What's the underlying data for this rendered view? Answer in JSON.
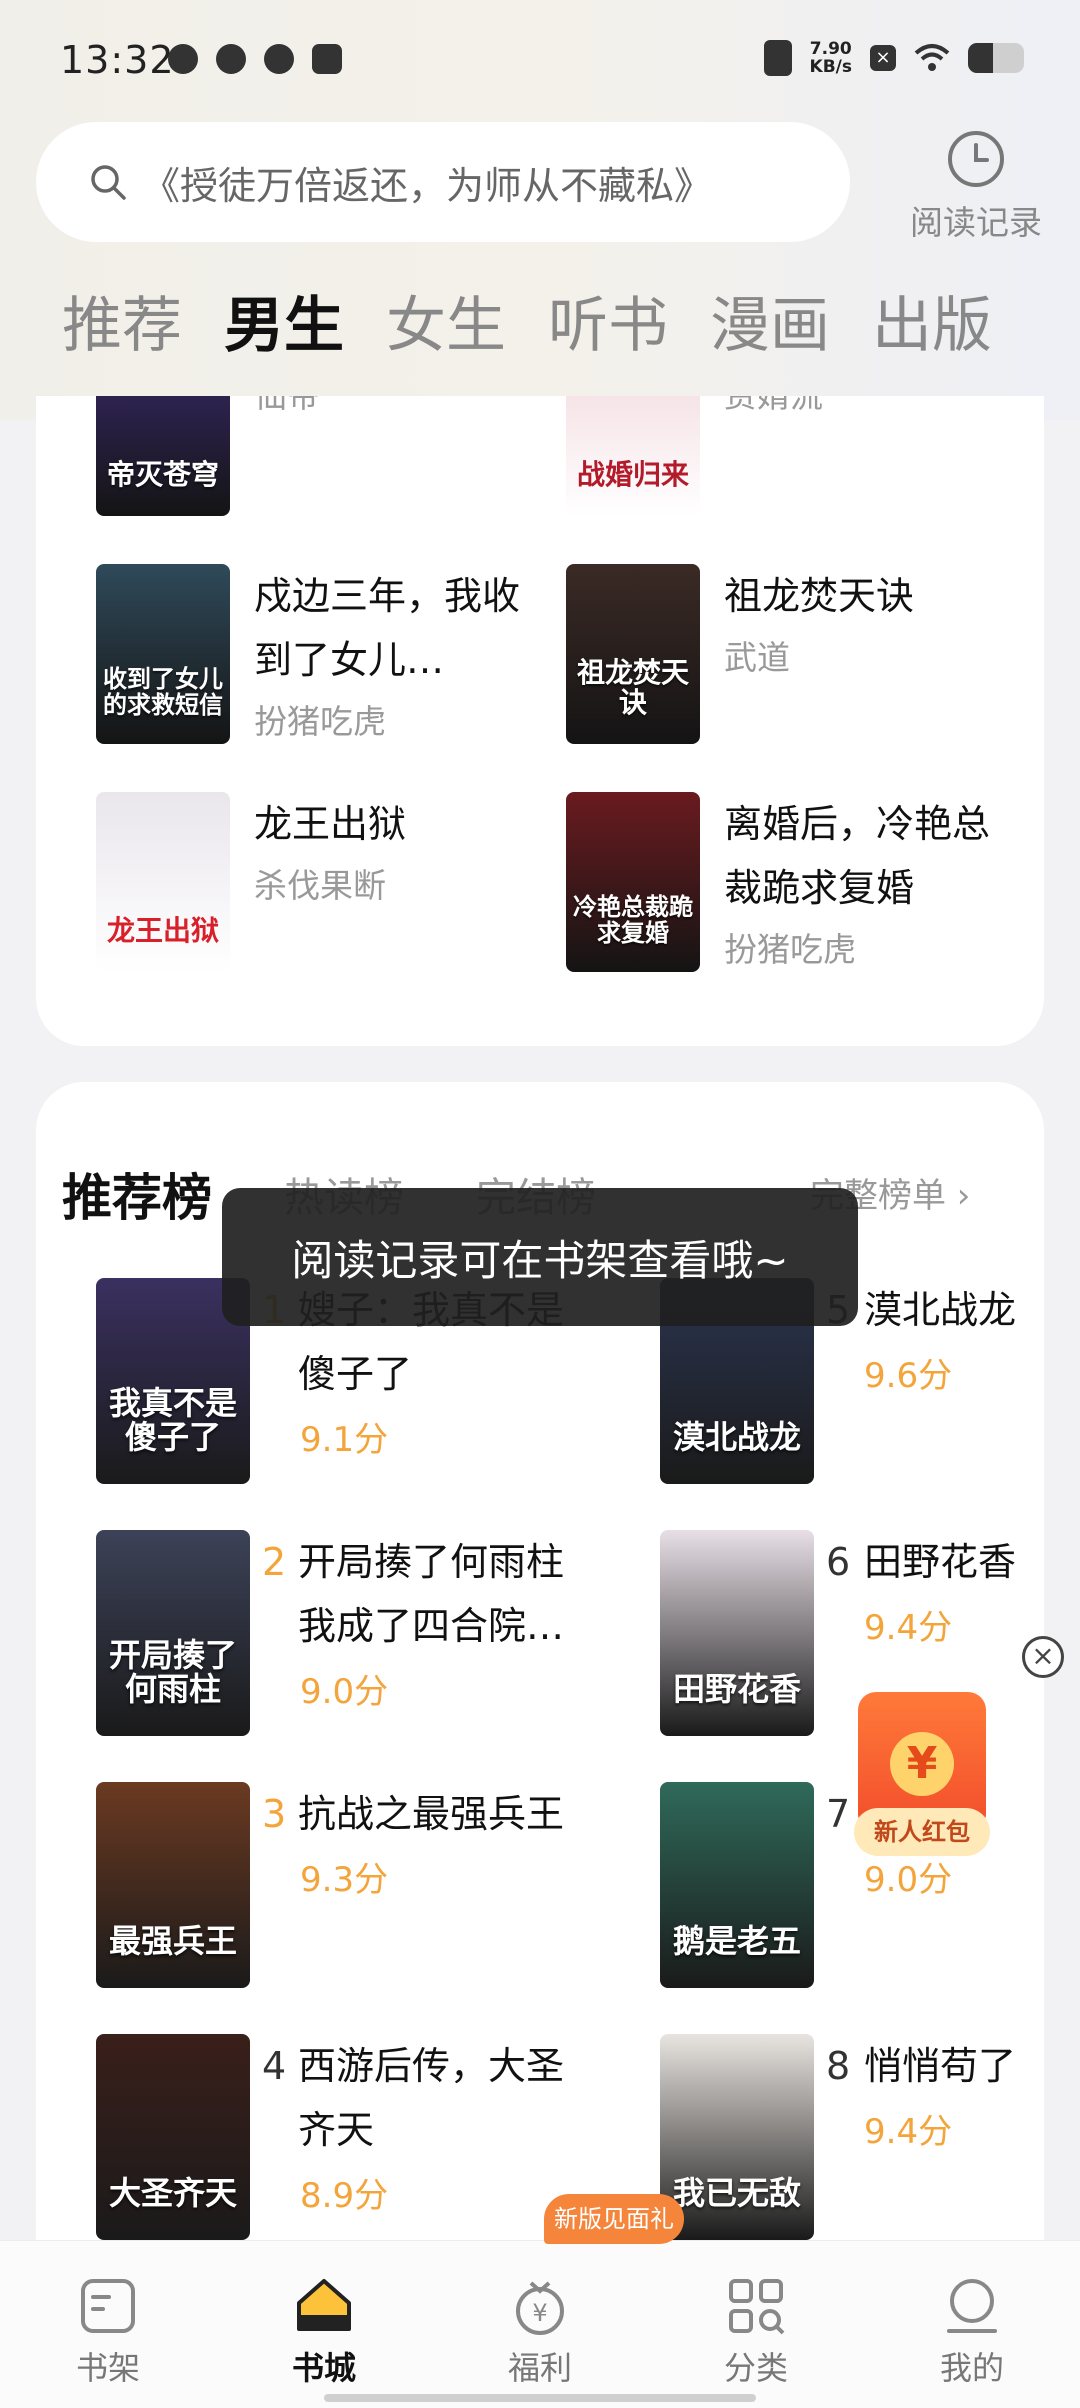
{
  "status_bar": {
    "time": "13:32",
    "net_speed_value": "7.90",
    "net_speed_unit": "KB/s",
    "battery_level": 0.45
  },
  "search": {
    "placeholder": "《授徒万倍返还，为师从不藏私》",
    "history_label": "阅读记录"
  },
  "channel_tabs": [
    {
      "label": "推荐",
      "active": false
    },
    {
      "label": "男生",
      "active": true
    },
    {
      "label": "女生",
      "active": false
    },
    {
      "label": "听书",
      "active": false
    },
    {
      "label": "漫画",
      "active": false
    },
    {
      "label": "出版",
      "active": false
    }
  ],
  "book_grid": [
    {
      "title": "",
      "author": "仙帝",
      "cover_text": "帝灭苍穹",
      "cover_color": "#3a2a6e"
    },
    {
      "title": "",
      "author": "赘婿流",
      "cover_text": "战婚归来",
      "cover_color": "#f1d6dc"
    },
    {
      "title": "戍边三年，我收到了女儿…",
      "author": "扮猪吃虎",
      "cover_text": "收到了女儿的求救短信",
      "cover_color": "#2f4a5a"
    },
    {
      "title": "祖龙焚天诀",
      "author": "武道",
      "cover_text": "祖龙焚天诀",
      "cover_color": "#3b2a25"
    },
    {
      "title": "龙王出狱",
      "author": "杀伐果断",
      "cover_text": "龙王出狱",
      "cover_color": "#e9e6ec"
    },
    {
      "title": "离婚后，冷艳总裁跪求复婚",
      "author": "扮猪吃虎",
      "cover_text": "冷艳总裁跪求复婚",
      "cover_color": "#6a1b1f"
    }
  ],
  "rank_tabs": [
    {
      "label": "推荐榜",
      "active": true
    },
    {
      "label": "热读榜",
      "active": false
    },
    {
      "label": "完结榜",
      "active": false
    }
  ],
  "full_rank_label": "完整榜单 ›",
  "rankings": [
    {
      "rank": "1",
      "title": "嫂子：我真不是傻子了",
      "score": "9.1分",
      "cover_text": "我真不是傻子了",
      "cover_color": "#3a3160"
    },
    {
      "rank": "2",
      "title": "开局揍了何雨柱我成了四合院…",
      "score": "9.0分",
      "cover_text": "开局揍了何雨柱",
      "cover_color": "#3c4258"
    },
    {
      "rank": "3",
      "title": "抗战之最强兵王",
      "score": "9.3分",
      "cover_text": "最强兵王",
      "cover_color": "#6b3a22"
    },
    {
      "rank": "4",
      "title": "西游后传，大圣齐天",
      "score": "8.9分",
      "cover_text": "大圣齐天",
      "cover_color": "#3a1f1a"
    },
    {
      "rank": "5",
      "title": "漠北战龙",
      "score": "9.6分",
      "cover_text": "漠北战龙",
      "cover_color": "#2b3550"
    },
    {
      "rank": "6",
      "title": "田野花香",
      "score": "9.4分",
      "cover_text": "田野花香",
      "cover_color": "#e8dfe6"
    },
    {
      "rank": "7",
      "title": "",
      "score": "9.0分",
      "cover_text": "鹅是老五",
      "cover_color": "#2f6a5a"
    },
    {
      "rank": "8",
      "title": "悄悄苟了",
      "score": "9.4分",
      "cover_text": "我已无敌",
      "cover_color": "#e9e4e0"
    }
  ],
  "toast": "阅读记录可在书架查看哦~",
  "red_packet": {
    "label": "新人红包",
    "symbol": "¥"
  },
  "bottom_nav": [
    {
      "label": "书架",
      "icon": "bookshelf-icon",
      "active": false
    },
    {
      "label": "书城",
      "icon": "home-icon",
      "active": true
    },
    {
      "label": "福利",
      "icon": "gift-bag-icon",
      "active": false
    },
    {
      "label": "分类",
      "icon": "grid-icon",
      "active": false
    },
    {
      "label": "我的",
      "icon": "profile-icon",
      "active": false
    }
  ],
  "nav_badge": "新版见面礼",
  "colors": {
    "accent": "#f3a43a",
    "toast_bg": "#202020",
    "badge": "#f5853a"
  }
}
